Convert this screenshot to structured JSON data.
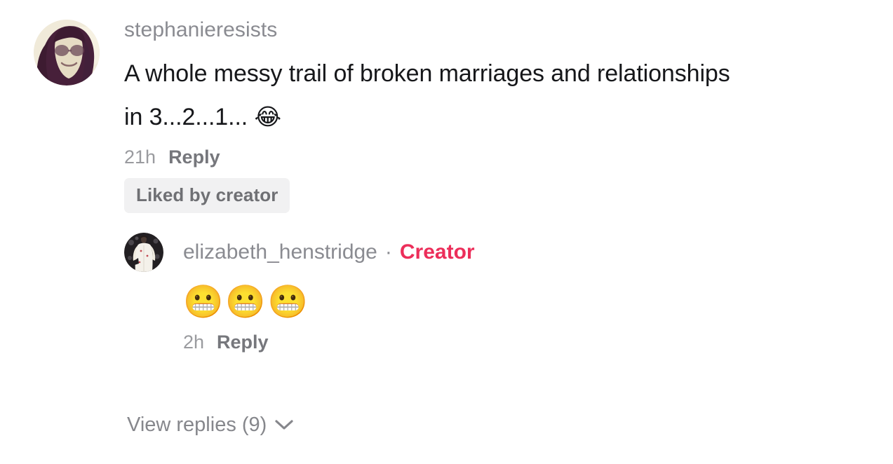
{
  "colors": {
    "background": "#ffffff",
    "body_text": "#16171a",
    "username_text": "#8a8b91",
    "meta_text": "#9a9b9f",
    "reply_action_text": "#76777c",
    "creator_accent": "#ec2e5a",
    "badge_background": "#f1f1f2",
    "badge_text": "#6f7074",
    "view_replies_text": "#86878c"
  },
  "comment": {
    "avatar_name": "stephanieresists-avatar",
    "username": "stephanieresists",
    "text": "A whole messy trail of broken marriages and relationships in 3...2...1... ",
    "text_emoji": "😂",
    "timestamp": "21h",
    "reply_label": "Reply",
    "liked_badge": "Liked by creator"
  },
  "reply": {
    "avatar_name": "elizabeth-henstridge-avatar",
    "username": "elizabeth_henstridge",
    "separator": "·",
    "creator_label": "Creator",
    "emojis": "😬😬😬",
    "timestamp": "2h",
    "reply_label": "Reply"
  },
  "view_replies": {
    "label": "View replies (9)",
    "count": 9,
    "chevron_icon": "chevron-down-icon"
  }
}
